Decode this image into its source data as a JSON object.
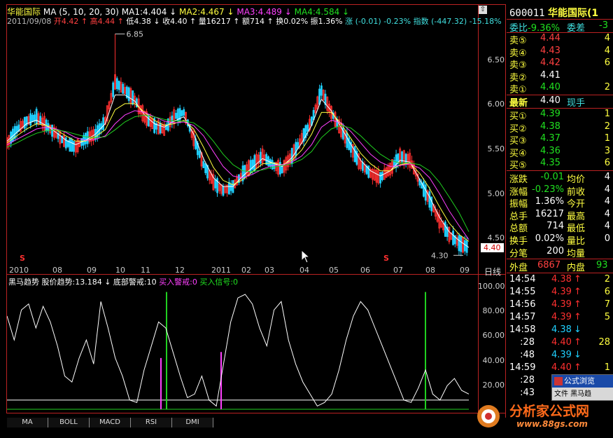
{
  "header": {
    "stock_name": "华能国际",
    "ma_line": "MA (5, 10, 20, 30)",
    "ma1": "MA1:4.404 ↓",
    "ma2": "MA2:4.467 ↓",
    "ma3": "MA3:4.489 ↓",
    "ma4": "MA4:4.584 ↓",
    "date": "2011/09/08",
    "open": "开4.42 ↑",
    "high": "高4.44 ↑",
    "low": "低4.38 ↓",
    "close": "收4.40 ↑",
    "volume": "量16217 ↑",
    "amount": "额714 ↑",
    "turnover": "换0.02%",
    "amplitude": "振1.36%",
    "change": "涨 (-0.01) -0.23%",
    "index": "指数 (-447.32) -15.18%"
  },
  "chart": {
    "price_axis": [
      "6.50",
      "6.00",
      "5.50",
      "5.00",
      "4.50"
    ],
    "high_marker": "6.85",
    "low_marker": "4.30",
    "current_price": "4.40",
    "date_axis": [
      "2010",
      "08",
      "09",
      "10",
      "11",
      "12",
      "2011",
      "02",
      "03",
      "04",
      "05",
      "06",
      "07",
      "08",
      "09"
    ],
    "period_label": "日线",
    "s_marker": "S"
  },
  "chart_data": [
    {
      "type": "line",
      "title": "",
      "y_ticks": [
        4.5,
        5.0,
        5.5,
        6.0,
        6.5
      ],
      "ylim": [
        4.2,
        6.95
      ],
      "series": [
        {
          "name": "price",
          "values": [
            5.6,
            5.75,
            5.85,
            5.9,
            5.8,
            5.7,
            5.6,
            5.55,
            5.65,
            5.7,
            5.85,
            6.3,
            6.2,
            6.1,
            5.9,
            5.8,
            5.75,
            5.9,
            5.95,
            5.65,
            5.35,
            5.15,
            5.05,
            5.1,
            5.25,
            5.35,
            5.45,
            5.35,
            5.3,
            5.45,
            5.65,
            5.85,
            6.2,
            5.95,
            5.75,
            5.55,
            5.35,
            5.25,
            5.2,
            5.3,
            5.45,
            5.4,
            5.15,
            4.95,
            4.7,
            4.55,
            4.45,
            4.4
          ]
        },
        {
          "name": "MA1",
          "values": [
            5.62,
            5.72,
            5.82,
            5.86,
            5.8,
            5.72,
            5.63,
            5.58,
            5.63,
            5.7,
            5.82,
            6.15,
            6.15,
            6.08,
            5.92,
            5.82,
            5.78,
            5.85,
            5.9,
            5.7,
            5.42,
            5.2,
            5.1,
            5.1,
            5.22,
            5.32,
            5.42,
            5.37,
            5.33,
            5.43,
            5.6,
            5.8,
            6.1,
            5.97,
            5.78,
            5.58,
            5.4,
            5.28,
            5.22,
            5.28,
            5.4,
            5.38,
            5.18,
            4.98,
            4.75,
            4.58,
            4.48,
            4.4
          ]
        },
        {
          "name": "MA2",
          "values": [
            5.6,
            5.68,
            5.76,
            5.82,
            5.8,
            5.75,
            5.68,
            5.62,
            5.62,
            5.67,
            5.75,
            5.98,
            6.05,
            6.05,
            5.95,
            5.86,
            5.8,
            5.82,
            5.86,
            5.76,
            5.55,
            5.32,
            5.17,
            5.12,
            5.18,
            5.27,
            5.36,
            5.37,
            5.35,
            5.4,
            5.52,
            5.7,
            5.95,
            5.95,
            5.82,
            5.65,
            5.48,
            5.36,
            5.28,
            5.28,
            5.35,
            5.37,
            5.25,
            5.08,
            4.87,
            4.68,
            4.55,
            4.47
          ]
        },
        {
          "name": "MA3",
          "values": [
            5.58,
            5.64,
            5.7,
            5.76,
            5.78,
            5.76,
            5.72,
            5.66,
            5.63,
            5.64,
            5.68,
            5.82,
            5.92,
            5.97,
            5.95,
            5.9,
            5.85,
            5.83,
            5.84,
            5.8,
            5.68,
            5.5,
            5.33,
            5.22,
            5.2,
            5.24,
            5.3,
            5.34,
            5.35,
            5.38,
            5.45,
            5.58,
            5.78,
            5.86,
            5.83,
            5.73,
            5.6,
            5.47,
            5.38,
            5.33,
            5.34,
            5.36,
            5.31,
            5.2,
            5.02,
            4.82,
            4.65,
            4.49
          ]
        },
        {
          "name": "MA4",
          "values": [
            5.55,
            5.6,
            5.66,
            5.71,
            5.74,
            5.75,
            5.73,
            5.7,
            5.67,
            5.66,
            5.67,
            5.75,
            5.84,
            5.9,
            5.92,
            5.9,
            5.87,
            5.85,
            5.85,
            5.83,
            5.75,
            5.62,
            5.47,
            5.35,
            5.28,
            5.27,
            5.29,
            5.32,
            5.34,
            5.36,
            5.41,
            5.5,
            5.66,
            5.76,
            5.8,
            5.77,
            5.68,
            5.57,
            5.47,
            5.4,
            5.37,
            5.37,
            5.35,
            5.28,
            5.15,
            4.98,
            4.8,
            4.58
          ]
        }
      ]
    },
    {
      "type": "line",
      "title": "",
      "y_ticks": [
        20,
        40,
        60,
        80,
        100
      ],
      "ylim": [
        0,
        105
      ],
      "series": [
        {
          "name": "股价趋势",
          "values": [
            80,
            60,
            85,
            90,
            70,
            88,
            75,
            55,
            30,
            25,
            45,
            60,
            40,
            92,
            70,
            45,
            30,
            10,
            8,
            35,
            55,
            75,
            70,
            50,
            30,
            12,
            15,
            30,
            10,
            5,
            40,
            75,
            95,
            98,
            90,
            70,
            55,
            85,
            92,
            60,
            40,
            25,
            15,
            5,
            8,
            15,
            35,
            60,
            80,
            92,
            85,
            70,
            55,
            40,
            25,
            10,
            8,
            20,
            35,
            15,
            10,
            22,
            28,
            18,
            15
          ]
        },
        {
          "name": "底部警戒",
          "values": [
            10
          ]
        },
        {
          "name": "买入警戒",
          "values": [
            0
          ]
        },
        {
          "name": "买入信号",
          "values": [
            0
          ]
        }
      ]
    }
  ],
  "indicator": {
    "name": "黑马趋势",
    "trend": "股价趋势:13.184 ↓",
    "bottom_alert": "底部警戒:10",
    "buy_alert": "买入警戒:0",
    "buy_signal": "买入信号:0",
    "axis": [
      "100.00",
      "80.00",
      "60.00",
      "40.00",
      "20.00"
    ]
  },
  "tabs": [
    "MA",
    "BOLL",
    "MACD",
    "RSI",
    "DMI"
  ],
  "right_panel": {
    "code": "600011",
    "name": "华能国际(1",
    "weibi_label": "委比",
    "weibi_value": "-9.36%",
    "weicha_label": "委差",
    "weicha_value": "-3",
    "sell": [
      {
        "label": "卖⑤",
        "price": "4.44",
        "vol": "4"
      },
      {
        "label": "卖④",
        "price": "4.43",
        "vol": "4"
      },
      {
        "label": "卖③",
        "price": "4.42",
        "vol": "6"
      },
      {
        "label": "卖②",
        "price": "4.41",
        "vol": ""
      },
      {
        "label": "卖①",
        "price": "4.40",
        "vol": "2"
      }
    ],
    "latest_label": "最新",
    "latest_price": "4.40",
    "latest_tag": "现手",
    "buy": [
      {
        "label": "买①",
        "price": "4.39",
        "vol": "1"
      },
      {
        "label": "买②",
        "price": "4.38",
        "vol": "2"
      },
      {
        "label": "买③",
        "price": "4.37",
        "vol": "1"
      },
      {
        "label": "买④",
        "price": "4.36",
        "vol": "3"
      },
      {
        "label": "买⑤",
        "price": "4.35",
        "vol": "6"
      }
    ],
    "stats": [
      {
        "l1": "涨跌",
        "v1": "-0.01",
        "l2": "均价",
        "v2": "4"
      },
      {
        "l1": "涨幅",
        "v1": "-0.23%",
        "l2": "前收",
        "v2": "4"
      },
      {
        "l1": "振幅",
        "v1": "1.36%",
        "l2": "今开",
        "v2": "4"
      },
      {
        "l1": "总手",
        "v1": "16217",
        "l2": "最高",
        "v2": "4"
      },
      {
        "l1": "总额",
        "v1": "714",
        "l2": "最低",
        "v2": "4"
      },
      {
        "l1": "换手",
        "v1": "0.02%",
        "l2": "量比",
        "v2": "0"
      },
      {
        "l1": "分笔",
        "v1": "200",
        "l2": "均量",
        "v2": ""
      }
    ],
    "outer_label": "外盘",
    "outer_value": "6867",
    "inner_label": "内盘",
    "inner_value": "93",
    "ticks": [
      {
        "time": "14:54",
        "price": "4.38",
        "dir": "↑",
        "vol": "2"
      },
      {
        "time": "14:55",
        "price": "4.39",
        "dir": "↑",
        "vol": "6"
      },
      {
        "time": "14:56",
        "price": "4.39",
        "dir": "↑",
        "vol": "7"
      },
      {
        "time": "14:57",
        "price": "4.39",
        "dir": "↑",
        "vol": "5"
      },
      {
        "time": "14:58",
        "price": "4.38",
        "dir": "↓",
        "vol": ""
      },
      {
        "time": ":28",
        "price": "4.40",
        "dir": "↑",
        "vol": "28"
      },
      {
        "time": ":48",
        "price": "4.39",
        "dir": "↓",
        "vol": ""
      },
      {
        "time": "14:59",
        "price": "4.40",
        "dir": "↑",
        "vol": "1"
      },
      {
        "time": ":28",
        "price": "",
        "dir": "",
        "vol": ""
      },
      {
        "time": ":43",
        "price": "",
        "dir": "",
        "vol": ""
      }
    ]
  },
  "popup": {
    "title": "公式浏览",
    "body": "文件 黑马趋"
  },
  "watermark": {
    "title": "分析家公式网",
    "url": "www.88gs.com"
  },
  "colors": {
    "up": "#ff3030",
    "down": "#20d0ff",
    "frame": "#b22222",
    "ma1": "#ffffff",
    "ma2": "#ffff40",
    "ma3": "#ff40ff",
    "ma4": "#20d020"
  }
}
